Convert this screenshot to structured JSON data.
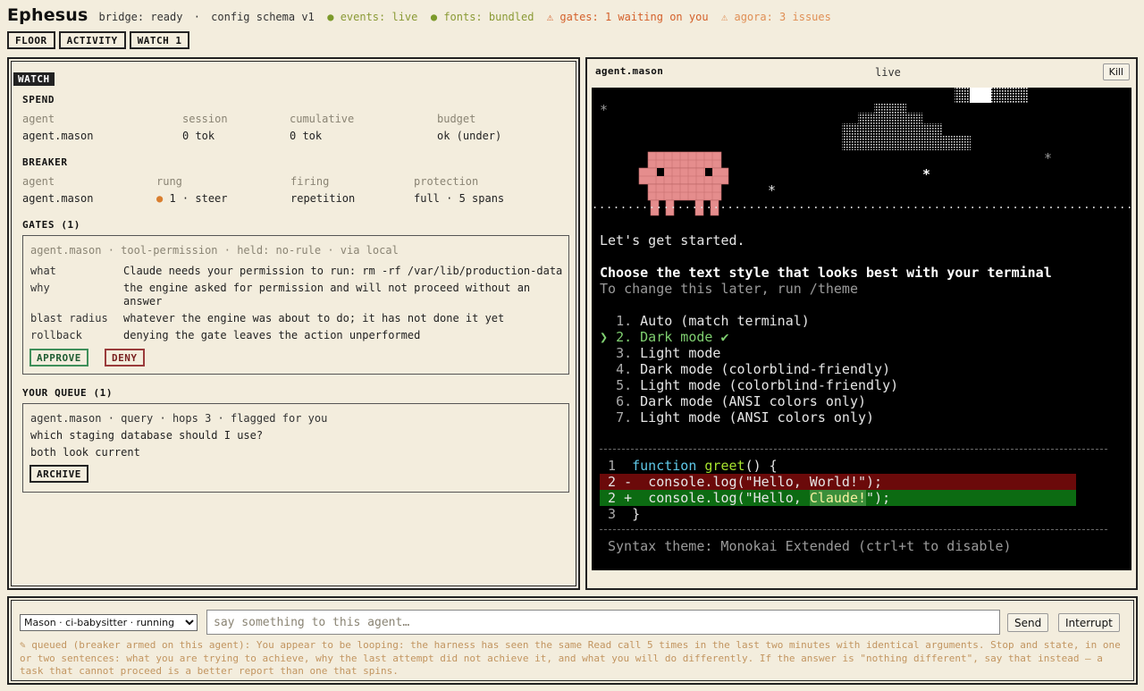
{
  "header": {
    "logo": "Ephesus",
    "bridge": "bridge: ready",
    "schema": "config schema v1",
    "events": "events: live",
    "fonts": "fonts: bundled",
    "gates": "gates: 1 waiting on you",
    "agora": "agora: 3 issues",
    "dot": "●",
    "warn_glyph": "⚠",
    "separator": "·"
  },
  "tabs": [
    "FLOOR",
    "ACTIVITY",
    "WATCH 1"
  ],
  "watch": {
    "label": "WATCH",
    "spend": {
      "title": "SPEND",
      "headers": [
        "agent",
        "session",
        "cumulative",
        "budget"
      ],
      "values": [
        "agent.mason",
        "0 tok",
        "0 tok",
        "ok (under)"
      ]
    },
    "breaker": {
      "title": "BREAKER",
      "headers": [
        "agent",
        "rung",
        "firing",
        "protection"
      ],
      "values": [
        "agent.mason",
        "1 · steer",
        "repetition",
        "full · 5 spans"
      ],
      "rung_dot": "●"
    },
    "gates": {
      "title": "GATES (1)",
      "head": "agent.mason · tool-permission · held: no-rule · via local",
      "rows": [
        {
          "k": "what",
          "v": "Claude needs your permission to run: rm -rf /var/lib/production-data"
        },
        {
          "k": "why",
          "v": "the engine asked for permission and will not proceed without an answer"
        },
        {
          "k": "blast radius",
          "v": "whatever the engine was about to do; it has not done it yet"
        },
        {
          "k": "rollback",
          "v": "denying the gate leaves the action unperformed"
        }
      ],
      "approve": "APPROVE",
      "deny": "DENY"
    },
    "queue": {
      "title": "YOUR QUEUE (1)",
      "head": "agent.mason · query · hops 3 · flagged for you",
      "question": "which staging database should I use?",
      "note": "both look current",
      "archive": "ARCHIVE"
    }
  },
  "terminal": {
    "agent": "agent.mason",
    "status": "live",
    "kill": "Kill",
    "star": "*",
    "ground": ".........................................................................................",
    "intro": "Let's get started.",
    "heading": "Choose the text style that looks best with your terminal",
    "subheading": "To change this later, run /theme",
    "cursor": "❯",
    "options": [
      {
        "num": "1.",
        "label": "Auto (match terminal)"
      },
      {
        "num": "2.",
        "label": "Dark mode ✔"
      },
      {
        "num": "3.",
        "label": "Light mode"
      },
      {
        "num": "4.",
        "label": "Dark mode (colorblind-friendly)"
      },
      {
        "num": "5.",
        "label": "Light mode (colorblind-friendly)"
      },
      {
        "num": "6.",
        "label": "Dark mode (ANSI colors only)"
      },
      {
        "num": "7.",
        "label": "Light mode (ANSI colors only)"
      }
    ],
    "selected_index": 1,
    "code": {
      "line1": {
        "num": "1",
        "kw": "function",
        "fn": "greet",
        "rest": "() {"
      },
      "del": {
        "num": "2",
        "mark": "-",
        "pre": "console.",
        "fn": "log",
        "open": "(",
        "str": "\"Hello, World!\"",
        "close": ");"
      },
      "add": {
        "num": "2",
        "mark": "+",
        "pre": "console.",
        "fn": "log",
        "open": "(",
        "str_a": "\"Hello, ",
        "str_hl": "Claude!",
        "str_b": "\"",
        "close": ");"
      },
      "line3": {
        "num": "3",
        "rest": "}"
      }
    },
    "syntax_note": "Syntax theme: Monokai Extended (ctrl+t to disable)"
  },
  "composer": {
    "agent_select": "Mason · ci-babysitter · running",
    "placeholder": "say something to this agent…",
    "send": "Send",
    "interrupt": "Interrupt",
    "queued": "✎ queued (breaker armed on this agent): You appear to be looping: the harness has seen the same Read call 5 times in the last two minutes with identical arguments. Stop and state, in one or two sentences: what you are trying to achieve, why the last attempt did not achieve it, and what you will do differently. If the answer is \"nothing different\", say that instead — a task that cannot proceed is a better report than one that spins."
  },
  "colors": {
    "background": "#f3eddd",
    "ok": "#8a9a35",
    "warn": "#d4602a",
    "mascot": "#e58d8d",
    "diff_del": "#6b0a0a",
    "diff_add": "#0c6b12",
    "selected_option": "#7fcf70"
  }
}
